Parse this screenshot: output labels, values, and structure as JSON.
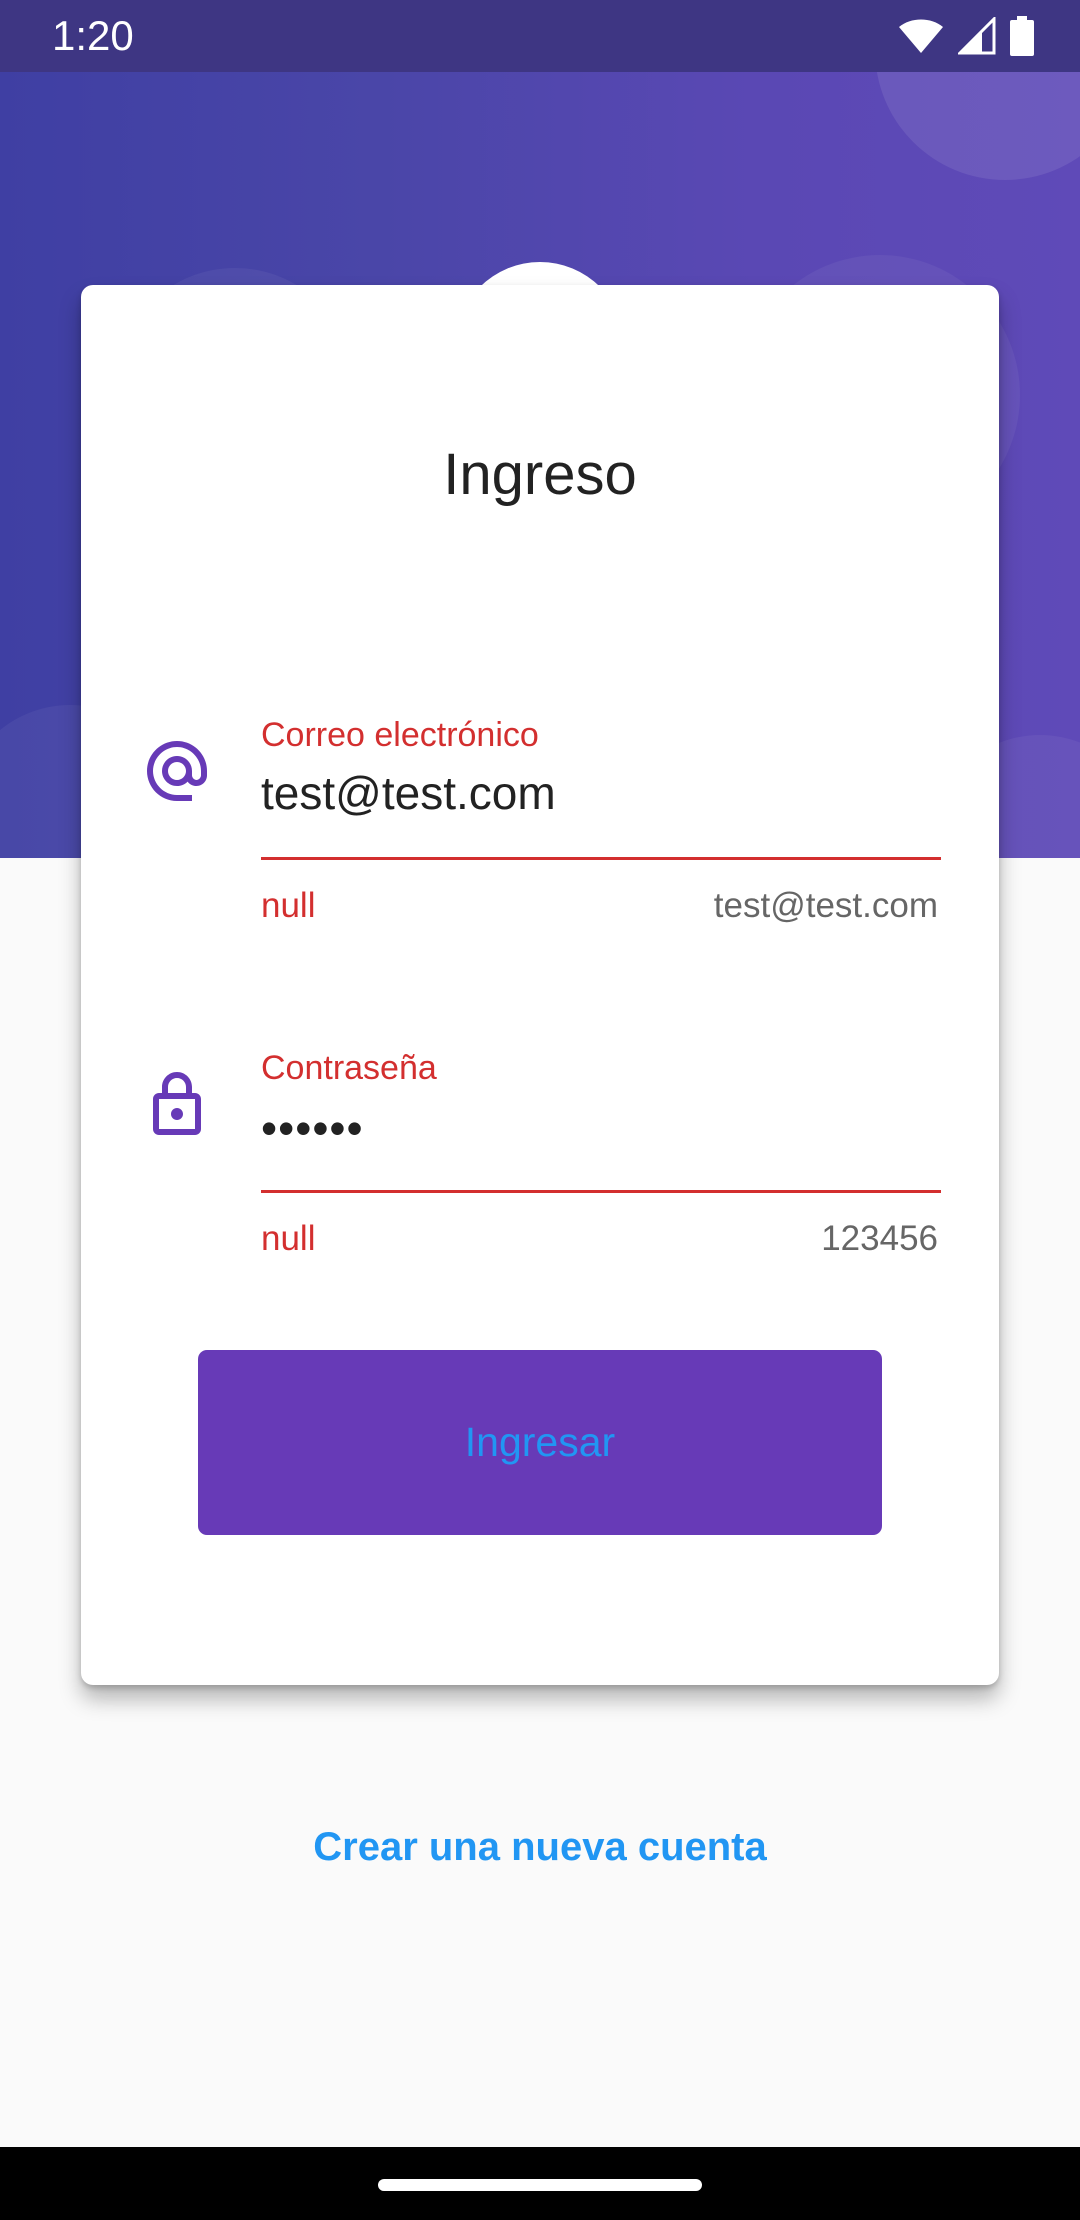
{
  "status_bar": {
    "time": "1:20",
    "icons": [
      "wifi-icon",
      "cell-signal-icon",
      "battery-icon"
    ]
  },
  "login_card": {
    "title": "Ingreso",
    "email_field": {
      "label": "Correo electrónico",
      "value": "test@test.com",
      "error_text": "null",
      "counter_text": "test@test.com",
      "icon": "at-sign-icon"
    },
    "password_field": {
      "label": "Contraseña",
      "value": "••••••",
      "error_text": "null",
      "counter_text": "123456",
      "icon": "lock-icon"
    },
    "submit_label": "Ingresar"
  },
  "create_account_link": "Crear una nueva cuenta",
  "colors": {
    "header_gradient_start": "#3f3fa3",
    "header_gradient_end": "#5f4ab8",
    "status_bar": "#3e3683",
    "icon_purple": "#673ab7",
    "button_background": "#673ab7",
    "link_blue": "#2196f3",
    "error_red": "#d32f2f"
  }
}
